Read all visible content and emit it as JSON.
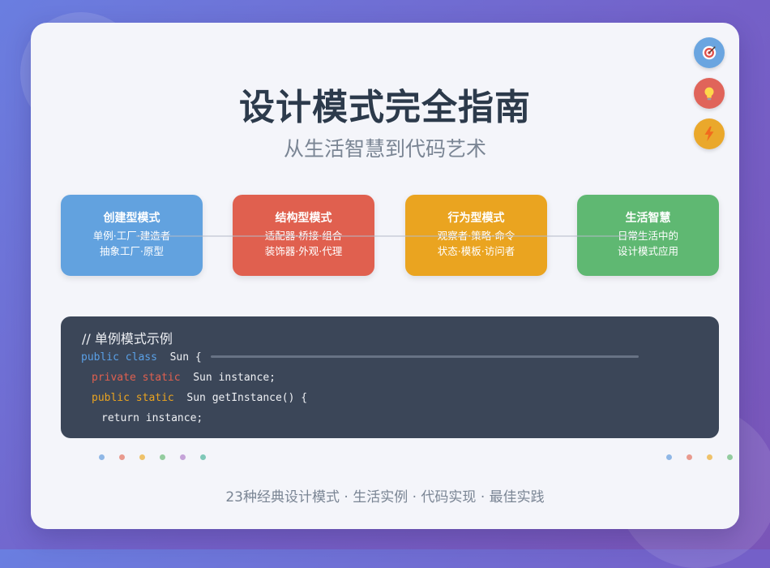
{
  "header": {
    "title": "设计模式完全指南",
    "subtitle": "从生活智慧到代码艺术"
  },
  "side_icons": [
    "target-icon",
    "lightbulb-icon",
    "lightning-icon"
  ],
  "categories": [
    {
      "title": "创建型模式",
      "line1": "单例·工厂·建造者",
      "line2": "抽象工厂·原型",
      "color": "#62a2df"
    },
    {
      "title": "结构型模式",
      "line1": "适配器·桥接·组合",
      "line2": "装饰器·外观·代理",
      "color": "#e0604f"
    },
    {
      "title": "行为型模式",
      "line1": "观察者·策略·命令",
      "line2": "状态·模板·访问者",
      "color": "#eaa420"
    },
    {
      "title": "生活智慧",
      "line1": "日常生活中的",
      "line2": "设计模式应用",
      "color": "#5fb872"
    }
  ],
  "code": {
    "comment": "// 单例模式示例",
    "line1": {
      "kw": "public class",
      "rest": "  Sun {"
    },
    "line2": {
      "kw": "private static",
      "rest": "  Sun instance;"
    },
    "line3": {
      "kw": "public static",
      "rest": "  Sun getInstance() {"
    },
    "line4": "return instance;"
  },
  "footer": "23种经典设计模式 · 生活实例 · 代码实现 · 最佳实践"
}
